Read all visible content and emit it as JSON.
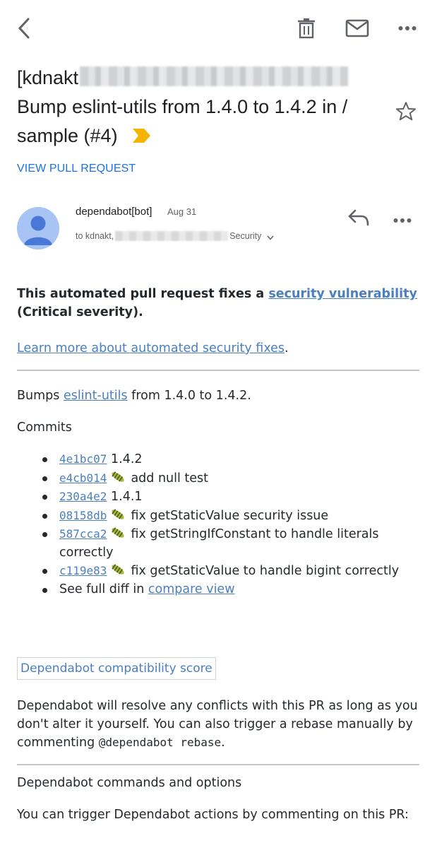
{
  "toolbar": {
    "back_icon": "back-arrow-icon",
    "delete_icon": "trash-icon",
    "mark_unread_icon": "envelope-icon",
    "more_icon": "more-horizontal-icon"
  },
  "subject": {
    "prefix": "[kdnakt",
    "rest": "Bump eslint-utils from 1.4.0 to 1.4.2 in / sample (#4)",
    "important_color": "#f4b400",
    "starred": false
  },
  "view_pr_label": "VIEW PULL REQUEST",
  "message": {
    "sender": "dependabot[bot]",
    "date": "Aug 31",
    "to_prefix": "to kdnakt,",
    "to_suffix": "Security",
    "avatar_color": "#a7c4f5"
  },
  "body": {
    "intro_before": "This automated pull request fixes a ",
    "intro_link": "security vulnerability",
    "intro_after": " (Critical severity).",
    "learn_more_link": "Learn more about automated security fixes",
    "learn_more_after": ".",
    "bumps_before": "Bumps ",
    "bumps_link": "eslint-utils",
    "bumps_after": " from 1.4.0 to 1.4.2.",
    "commits_heading": "Commits",
    "commits": [
      {
        "sha": "4e1bc07",
        "bug": false,
        "message": "1.4.2"
      },
      {
        "sha": "e4cb014",
        "bug": true,
        "message": "add null test"
      },
      {
        "sha": "230a4e2",
        "bug": false,
        "message": "1.4.1"
      },
      {
        "sha": "08158db",
        "bug": true,
        "message": "fix getStaticValue security issue"
      },
      {
        "sha": "587cca2",
        "bug": true,
        "message": "fix getStringIfConstant to handle literals correctly"
      },
      {
        "sha": "c119e83",
        "bug": true,
        "message": "fix getStaticValue to handle bigint correctly"
      }
    ],
    "diff_before": "See full diff in ",
    "diff_link": "compare view",
    "compat_badge": "Dependabot compatibility score",
    "resolve_text": "Dependabot will resolve any conflicts with this PR as long as you don't alter it yourself. You can also trigger a rebase manually by commenting ",
    "resolve_code": "@dependabot rebase",
    "resolve_after": ".",
    "commands_heading": "Dependabot commands and options",
    "commands_text": "You can trigger Dependabot actions by commenting on this PR:"
  },
  "colors": {
    "link": "#4a7fc1",
    "accent": "#1a73e8"
  }
}
